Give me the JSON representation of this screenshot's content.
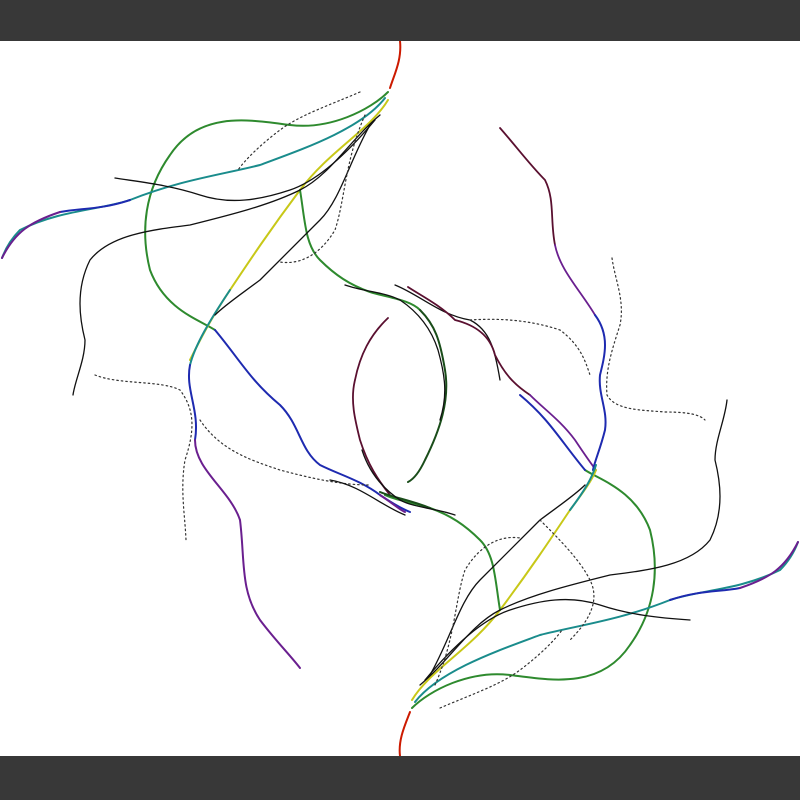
{
  "colors": {
    "frame": "#383838",
    "canvas": "#ffffff",
    "black_line": "#111111",
    "dotted_line": "#333333",
    "red": "#cc1a00",
    "orange": "#d46a10",
    "yellow": "#c8c818",
    "green": "#2e8a2e",
    "dark_green": "#1a4d1a",
    "teal": "#1a8c8c",
    "blue": "#1e2ab0",
    "purple": "#6a1f8f",
    "maroon": "#5a1030"
  },
  "artwork": {
    "description_type": "abstract-generative-lines",
    "color_legend": []
  }
}
